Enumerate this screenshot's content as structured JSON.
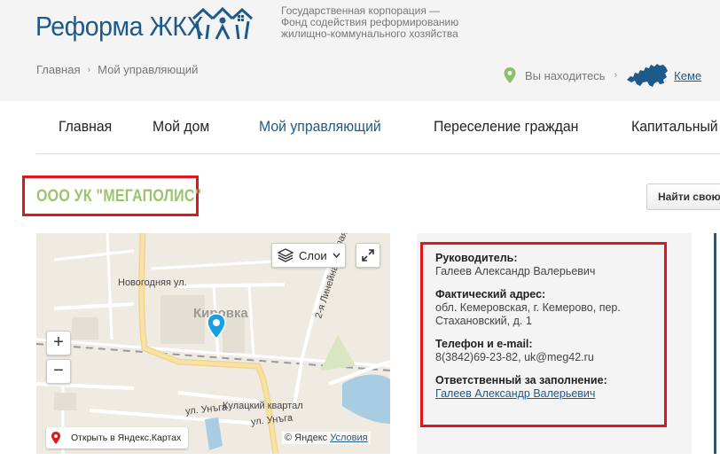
{
  "header": {
    "logo_text": "Реформа ЖКХ",
    "corporation": [
      "Государственная корпорация —",
      "Фонд содействия реформированию",
      "жилищно-коммунального хозяйства"
    ]
  },
  "breadcrumb": {
    "home": "Главная",
    "current": "Мой управляющий"
  },
  "location": {
    "label": "Вы находитесь",
    "region": "Кеме"
  },
  "nav": {
    "items": [
      "Главная",
      "Мой дом",
      "Мой управляющий",
      "Переселение граждан",
      "Капитальный р"
    ],
    "active_index": 2
  },
  "org": {
    "title": "ООО УК \"МЕГАПОЛИС\""
  },
  "find_button": "Найти свою",
  "map": {
    "layers_label": "Слои",
    "district": "Кировка",
    "streets": [
      "Новогодняя ул.",
      "2-я Линейная ул.",
      "Кулацкий квартал",
      "ул. Унъга",
      "ул. Унъга",
      "орая"
    ],
    "zoom_in": "+",
    "zoom_out": "−",
    "open_yandex": "Открыть в Яндекс.Картах",
    "copyright": "© Яндекс",
    "terms": "Условия"
  },
  "info": {
    "manager_label": "Руководитель:",
    "manager_value": "Галеев Александр Валерьевич",
    "address_label": "Фактический адрес:",
    "address_value": "обл. Кемеровская, г. Кемерово, пер. Стахановский, д. 1",
    "contact_label": "Телефон и e-mail:",
    "contact_value": "8(3842)69-23-82, uk@meg42.ru",
    "responsible_label": "Ответственный за заполнение:",
    "responsible_value": "Галеев Александр Валерьевич"
  },
  "colors": {
    "brand": "#1d5a8c",
    "accent_green": "#9bc46d",
    "highlight_red": "#e0161d"
  }
}
